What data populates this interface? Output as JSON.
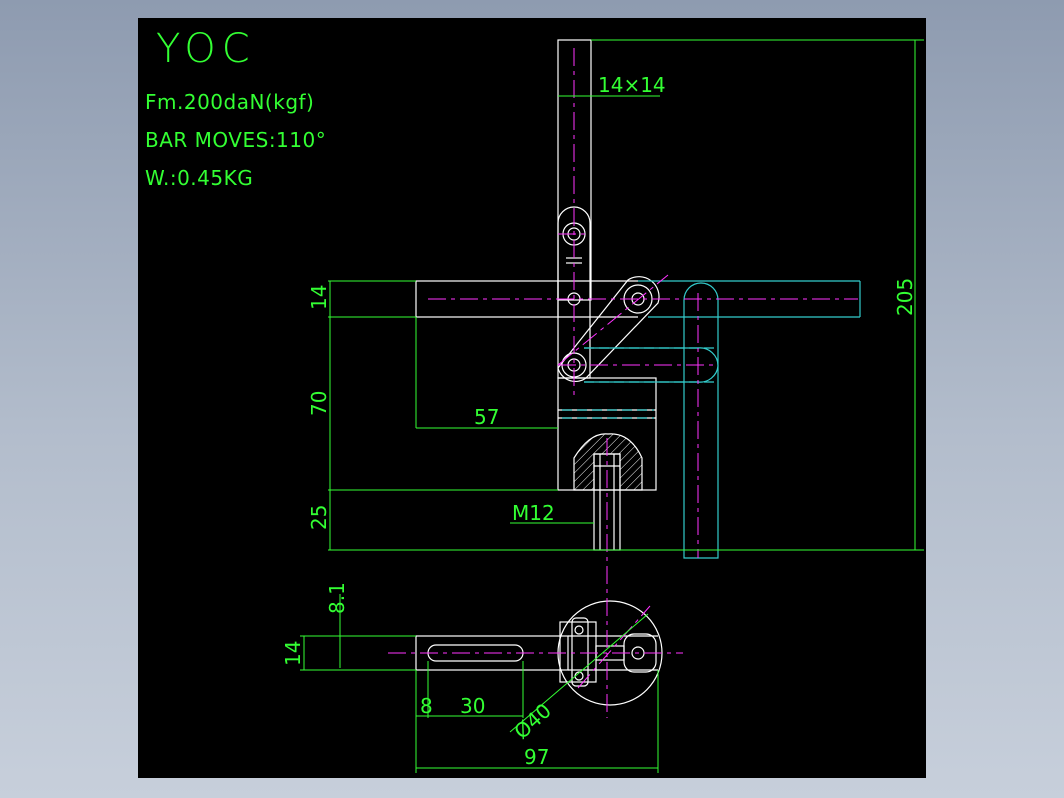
{
  "specs": {
    "model": "YOC",
    "force": "Fm.200daN(kgf)",
    "bar_moves": "BAR MOVES:110°",
    "weight": "W.:0.45KG"
  },
  "dimensions": {
    "bar_section": "14×14",
    "total_height": "205",
    "arm_thickness": "14",
    "mid_height": "70",
    "base_height": "25",
    "reach": "57",
    "thread": "M12",
    "slot_offset": "8.1",
    "slot_width": "14",
    "slot_start": "8",
    "slot_length": "30",
    "base_diameter": "Ø40",
    "overall_length": "97"
  },
  "colors": {
    "background": "#000000",
    "outline": "#ffffff",
    "dimension": "#33ff33",
    "centerline": "#ff33ff",
    "open_position": "#33cccc"
  }
}
